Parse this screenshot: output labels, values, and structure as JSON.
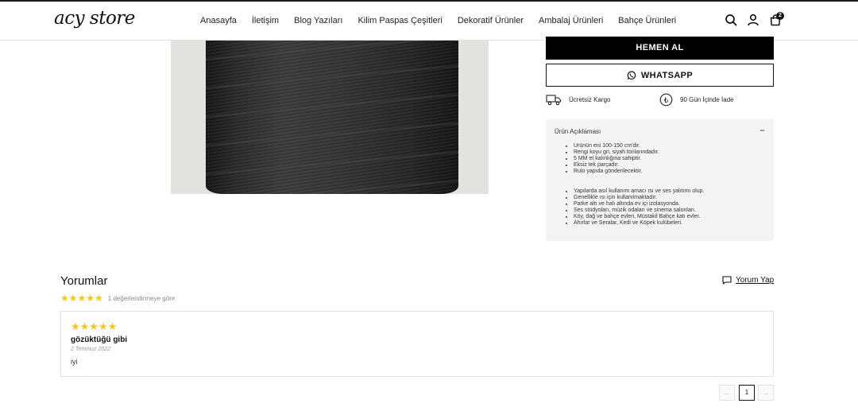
{
  "header": {
    "logo": "acy store",
    "nav": [
      "Anasayfa",
      "İletişim",
      "Blog Yazıları",
      "Kilim Paspas Çeşitleri",
      "Dekoratif Ürünler",
      "Ambalaj Ürünleri",
      "Bahçe Ürünleri"
    ],
    "icons": [
      "search-icon",
      "user-icon",
      "cart-icon"
    ],
    "cart_count": "2"
  },
  "product": {
    "buy_now_label": "HEMEN AL",
    "whatsapp_label": "WHATSAPP",
    "features": [
      {
        "icon": "truck-icon",
        "label": "Ücretsiz Kargo"
      },
      {
        "icon": "lira-icon",
        "label": "90 Gün İçinde İade"
      }
    ],
    "description": {
      "title": "Ürün Açıklaması",
      "toggle": "−",
      "list1": [
        "Urünün eni 100-150 cm'dir.",
        "Rengi koyu gri, siyah tonlarındadır.",
        "5 MM et kalınlığına sahiptir.",
        "Eksiz tek parçadır.",
        "Rulo yapıda gönderilecektir."
      ],
      "list2": [
        "Yapılarda asıl kullanım amacı ısı ve ses yalıtımı olup.",
        "Genellikle ısı için kullanılmaktadır.",
        "Parke altı ve halı altında ev içi izolasyonda.",
        "Ses stüdyoları, müzik odaları ve sinema salonları.",
        "Köy, dağ ve bahçe evleri, Müstakil Bahçe katı evler.",
        "Ahırlar ve Seralar, Kedi ve Köpek kulübeleri."
      ]
    }
  },
  "reviews": {
    "title": "Yorumlar",
    "summary_stars": "★★★★★",
    "summary_count": "1 değerlendirmeye göre",
    "write_label": "Yorum Yap",
    "items": [
      {
        "stars": "★★★★★",
        "headline": "gözüktüğü gibi",
        "date": "2 Temmuz 2022",
        "body": "iyi"
      }
    ]
  },
  "pagination": {
    "prev": "←",
    "current": "1",
    "next": "→"
  },
  "colors": {
    "star": "#f5c518",
    "primary_button": "#000000",
    "desc_bg": "#f4f4f4"
  }
}
